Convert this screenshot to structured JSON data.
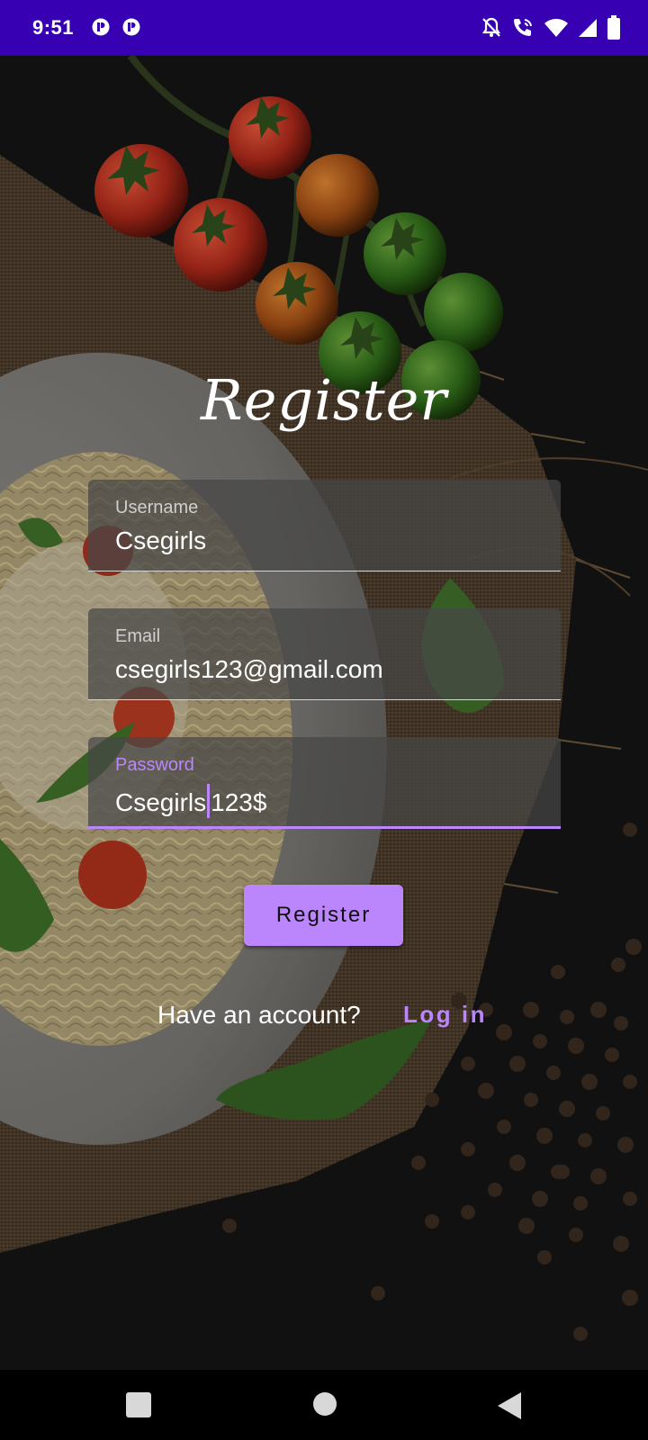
{
  "status_bar": {
    "time": "9:51",
    "icons": [
      "app-notification-icon",
      "app-notification-icon",
      "notifications-off-icon",
      "wifi-call-icon",
      "wifi-icon",
      "signal-icon",
      "battery-icon"
    ]
  },
  "form": {
    "title": "Register",
    "username": {
      "label": "Username",
      "value": "Csegirls"
    },
    "email": {
      "label": "Email",
      "value": "csegirls123@gmail.com"
    },
    "password": {
      "label": "Password",
      "value_before_cursor": "Csegirls",
      "value_after_cursor": "123$"
    },
    "register_button": "Register",
    "account_prompt": "Have an account?",
    "login_link": "Log in"
  },
  "navigation": {
    "buttons": [
      "recents-icon",
      "home-icon",
      "back-icon"
    ]
  },
  "colors": {
    "status_bar": "#3700b3",
    "accent": "#bb86fc",
    "background": "#141414",
    "field_background": "#464646"
  }
}
